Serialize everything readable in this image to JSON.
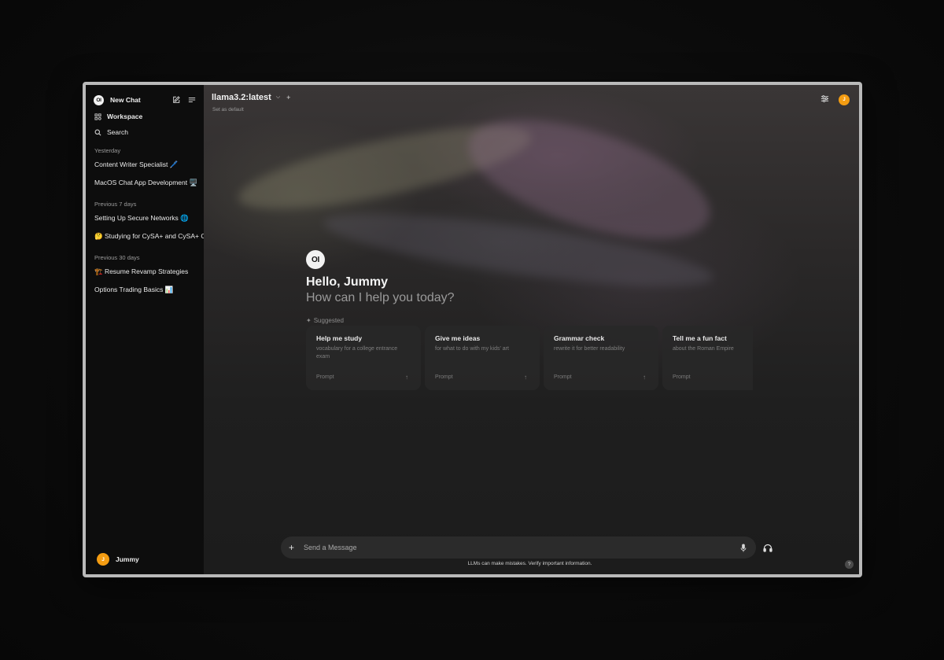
{
  "sidebar": {
    "logo_text": "OI",
    "new_chat_label": "New Chat",
    "workspace_label": "Workspace",
    "search_label": "Search",
    "groups": [
      {
        "label": "Yesterday",
        "chats": [
          "Content Writer Specialist 🖊️",
          "MacOS Chat App Development 🖥️"
        ]
      },
      {
        "label": "Previous 7 days",
        "chats": [
          "Setting Up Secure Networks 🌐",
          "🤔 Studying for CySA+ and CySA+ Certification"
        ]
      },
      {
        "label": "Previous 30 days",
        "chats": [
          "🏗️ Resume Revamp Strategies",
          "Options Trading Basics 📊"
        ]
      }
    ],
    "user": {
      "initial": "J",
      "name": "Jummy"
    }
  },
  "header": {
    "model_name": "llama3.2:latest",
    "set_default_label": "Set as default",
    "user_initial": "J"
  },
  "main": {
    "logo_text": "OI",
    "hello": "Hello, Jummy",
    "help": "How can I help you today?",
    "suggested_label": "Suggested",
    "cards": [
      {
        "title": "Help me study",
        "subtitle": "vocabulary for a college entrance exam",
        "prompt": "Prompt"
      },
      {
        "title": "Give me ideas",
        "subtitle": "for what to do with my kids' art",
        "prompt": "Prompt"
      },
      {
        "title": "Grammar check",
        "subtitle": "rewrite it for better readability",
        "prompt": "Prompt"
      },
      {
        "title": "Tell me a fun fact",
        "subtitle": "about the Roman Empire",
        "prompt": "Prompt"
      }
    ]
  },
  "input": {
    "placeholder": "Send a Message",
    "disclaimer": "LLMs can make mistakes. Verify important information."
  },
  "help_button_label": "?",
  "colors": {
    "accent_avatar": "#f39c12",
    "sidebar_bg": "#0d0d0d"
  }
}
